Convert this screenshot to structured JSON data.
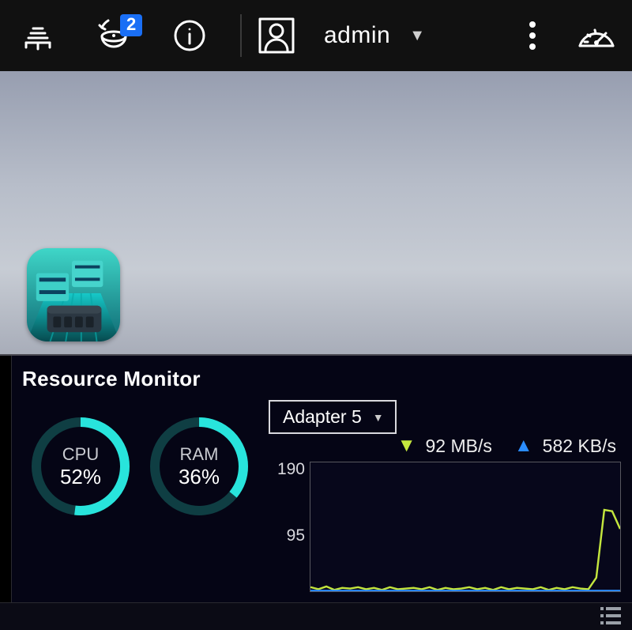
{
  "topbar": {
    "notifications_count": "2",
    "user_name": "admin"
  },
  "resource_monitor": {
    "title": "Resource Monitor",
    "cpu": {
      "label": "CPU",
      "value": "52%",
      "percent": 52
    },
    "ram": {
      "label": "RAM",
      "value": "36%",
      "percent": 36
    },
    "network": {
      "adapter_selected": "Adapter 5",
      "download_rate": "92 MB/s",
      "upload_rate": "582 KB/s",
      "y_tick_top": "190",
      "y_tick_mid": "95"
    }
  },
  "chart_data": {
    "type": "line",
    "title": "",
    "xlabel": "",
    "ylabel": "MB/s",
    "ylim": [
      0,
      190
    ],
    "x": [
      0,
      1,
      2,
      3,
      4,
      5,
      6,
      7,
      8,
      9,
      10,
      11,
      12,
      13,
      14,
      15,
      16,
      17,
      18,
      19,
      20,
      21,
      22,
      23,
      24,
      25,
      26,
      27,
      28,
      29,
      30,
      31,
      32,
      33,
      34,
      35,
      36,
      37,
      38,
      39
    ],
    "series": [
      {
        "name": "download",
        "color": "#c4e63e",
        "values": [
          6,
          3,
          7,
          2,
          5,
          4,
          6,
          3,
          5,
          2,
          6,
          3,
          4,
          5,
          3,
          6,
          2,
          5,
          3,
          4,
          6,
          3,
          5,
          2,
          6,
          3,
          5,
          4,
          3,
          6,
          2,
          5,
          3,
          6,
          4,
          3,
          20,
          120,
          118,
          92
        ]
      },
      {
        "name": "upload",
        "color": "#2a8cff",
        "values": [
          0.4,
          0.5,
          0.4,
          0.6,
          0.5,
          0.4,
          0.5,
          0.6,
          0.4,
          0.5,
          0.5,
          0.6,
          0.4,
          0.5,
          0.5,
          0.4,
          0.6,
          0.5,
          0.4,
          0.5,
          0.5,
          0.6,
          0.4,
          0.5,
          0.5,
          0.4,
          0.6,
          0.5,
          0.4,
          0.5,
          0.5,
          0.6,
          0.4,
          0.5,
          0.5,
          0.4,
          0.6,
          0.5,
          0.5,
          0.6
        ]
      }
    ]
  }
}
